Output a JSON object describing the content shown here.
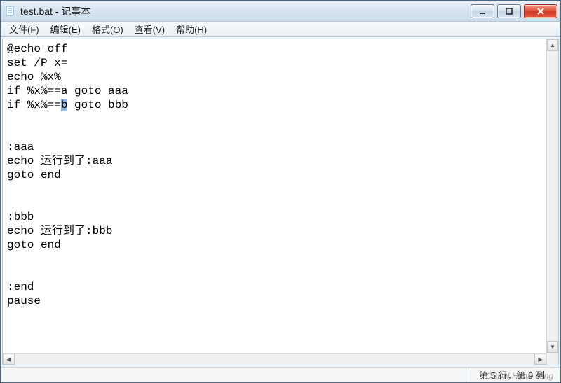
{
  "title": "test.bat - 记事本",
  "menu": {
    "file": "文件(F)",
    "edit": "编辑(E)",
    "format": "格式(O)",
    "view": "查看(V)",
    "help": "帮助(H)"
  },
  "editor": {
    "lines": [
      "@echo off",
      "set /P x=",
      "echo %x%",
      "if %x%==a goto aaa",
      "if %x%==b goto bbb",
      "",
      "",
      ":aaa",
      "echo 运行到了:aaa",
      "goto end",
      "",
      "",
      ":bbb",
      "echo 运行到了:bbb",
      "goto end",
      "",
      "",
      ":end",
      "pause"
    ],
    "selection": {
      "line": 4,
      "start": 8,
      "end": 9
    }
  },
  "status": {
    "position_label": "第 5 行，第 9 列"
  },
  "watermark": "CSDN Hann Yang",
  "icons": {
    "app": "notepad-icon",
    "minimize": "minimize-icon",
    "maximize": "maximize-icon",
    "close": "close-icon",
    "scroll_up": "chevron-up-icon",
    "scroll_down": "chevron-down-icon",
    "scroll_left": "chevron-left-icon",
    "scroll_right": "chevron-right-icon"
  }
}
